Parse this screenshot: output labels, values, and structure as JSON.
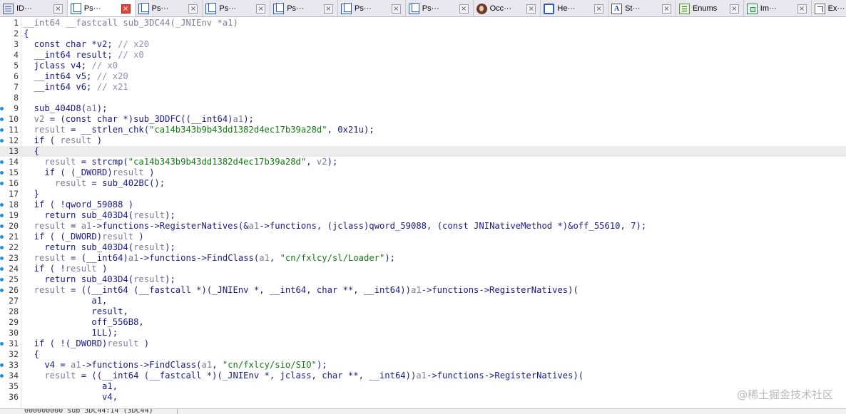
{
  "tabs": [
    {
      "label": "ID···",
      "icon": "ida-view-icon",
      "active": false
    },
    {
      "label": "Ps···",
      "icon": "pseudocode-icon",
      "active": true
    },
    {
      "label": "Ps···",
      "icon": "pseudocode-icon",
      "active": false
    },
    {
      "label": "Ps···",
      "icon": "pseudocode-icon",
      "active": false
    },
    {
      "label": "Ps···",
      "icon": "pseudocode-icon",
      "active": false
    },
    {
      "label": "Ps···",
      "icon": "pseudocode-icon",
      "active": false
    },
    {
      "label": "Ps···",
      "icon": "pseudocode-icon",
      "active": false
    },
    {
      "label": "Occ···",
      "icon": "occurrences-icon",
      "active": false
    },
    {
      "label": "He···",
      "icon": "hex-view-icon",
      "active": false
    },
    {
      "label": "St···",
      "icon": "strings-icon",
      "active": false
    },
    {
      "label": "Enums",
      "icon": "enums-icon",
      "active": false
    },
    {
      "label": "Im···",
      "icon": "imports-icon",
      "active": false
    },
    {
      "label": "Ex···",
      "icon": "exports-icon",
      "active": false
    }
  ],
  "tab_close_glyph": "×",
  "code": {
    "highlighted_line": 13,
    "breakpoint_lines": [
      9,
      10,
      11,
      12,
      14,
      15,
      16,
      18,
      19,
      20,
      21,
      22,
      23,
      24,
      25,
      26,
      31,
      33,
      34
    ],
    "lines": [
      [
        {
          "t": "__int64 __fastcall sub_3DC44(_JNIEnv *a1)",
          "c": "var"
        }
      ],
      [
        {
          "t": "{",
          "c": ""
        }
      ],
      [
        {
          "t": "  const char *v2; ",
          "c": ""
        },
        {
          "t": "// x20",
          "c": "cmt"
        }
      ],
      [
        {
          "t": "  __int64 result; ",
          "c": ""
        },
        {
          "t": "// x0",
          "c": "cmt"
        }
      ],
      [
        {
          "t": "  jclass v4; ",
          "c": ""
        },
        {
          "t": "// x0",
          "c": "cmt"
        }
      ],
      [
        {
          "t": "  __int64 v5; ",
          "c": ""
        },
        {
          "t": "// x20",
          "c": "cmt"
        }
      ],
      [
        {
          "t": "  __int64 v6; ",
          "c": ""
        },
        {
          "t": "// x21",
          "c": "cmt"
        }
      ],
      [
        {
          "t": "",
          "c": ""
        }
      ],
      [
        {
          "t": "  sub_404D8(",
          "c": ""
        },
        {
          "t": "a1",
          "c": "var"
        },
        {
          "t": ");",
          "c": ""
        }
      ],
      [
        {
          "t": "  v2",
          "c": "var"
        },
        {
          "t": " = (const char *)sub_3DDFC((__int64)",
          "c": ""
        },
        {
          "t": "a1",
          "c": "var"
        },
        {
          "t": ");",
          "c": ""
        }
      ],
      [
        {
          "t": "  result",
          "c": "var"
        },
        {
          "t": " = __strlen_chk(",
          "c": ""
        },
        {
          "t": "\"ca14b343b9b43dd1382d4ec17b39a28d\"",
          "c": "str"
        },
        {
          "t": ", 0x21u);",
          "c": ""
        }
      ],
      [
        {
          "t": "  if ( ",
          "c": ""
        },
        {
          "t": "result",
          "c": "var"
        },
        {
          "t": " )",
          "c": ""
        }
      ],
      [
        {
          "t": "  {",
          "c": ""
        }
      ],
      [
        {
          "t": "    result",
          "c": "var"
        },
        {
          "t": " = strcmp(",
          "c": ""
        },
        {
          "t": "\"ca14b343b9b43dd1382d4ec17b39a28d\"",
          "c": "str"
        },
        {
          "t": ", ",
          "c": ""
        },
        {
          "t": "v2",
          "c": "var"
        },
        {
          "t": ");",
          "c": ""
        }
      ],
      [
        {
          "t": "    if ( (_DWORD)",
          "c": ""
        },
        {
          "t": "result",
          "c": "var"
        },
        {
          "t": " )",
          "c": ""
        }
      ],
      [
        {
          "t": "      result",
          "c": "var"
        },
        {
          "t": " = sub_402BC();",
          "c": ""
        }
      ],
      [
        {
          "t": "  }",
          "c": ""
        }
      ],
      [
        {
          "t": "  if ( !qword_59088 )",
          "c": ""
        }
      ],
      [
        {
          "t": "    return sub_403D4(",
          "c": ""
        },
        {
          "t": "result",
          "c": "var"
        },
        {
          "t": ");",
          "c": ""
        }
      ],
      [
        {
          "t": "  result",
          "c": "var"
        },
        {
          "t": " = ",
          "c": ""
        },
        {
          "t": "a1",
          "c": "var"
        },
        {
          "t": "->functions->RegisterNatives(&",
          "c": ""
        },
        {
          "t": "a1",
          "c": "var"
        },
        {
          "t": "->functions, (jclass)qword_59088, (const JNINativeMethod *)&off_55610, 7);",
          "c": ""
        }
      ],
      [
        {
          "t": "  if ( (_DWORD)",
          "c": ""
        },
        {
          "t": "result",
          "c": "var"
        },
        {
          "t": " )",
          "c": ""
        }
      ],
      [
        {
          "t": "    return sub_403D4(",
          "c": ""
        },
        {
          "t": "result",
          "c": "var"
        },
        {
          "t": ");",
          "c": ""
        }
      ],
      [
        {
          "t": "  result",
          "c": "var"
        },
        {
          "t": " = (__int64)",
          "c": ""
        },
        {
          "t": "a1",
          "c": "var"
        },
        {
          "t": "->functions->FindClass(",
          "c": ""
        },
        {
          "t": "a1",
          "c": "var"
        },
        {
          "t": ", ",
          "c": ""
        },
        {
          "t": "\"cn/fxlcy/sl/Loader\"",
          "c": "str"
        },
        {
          "t": ");",
          "c": ""
        }
      ],
      [
        {
          "t": "  if ( !",
          "c": ""
        },
        {
          "t": "result",
          "c": "var"
        },
        {
          "t": " )",
          "c": ""
        }
      ],
      [
        {
          "t": "    return sub_403D4(",
          "c": ""
        },
        {
          "t": "result",
          "c": "var"
        },
        {
          "t": ");",
          "c": ""
        }
      ],
      [
        {
          "t": "  result",
          "c": "var"
        },
        {
          "t": " = ((__int64 (__fastcall *)(_JNIEnv *, __int64, char **, __int64))",
          "c": ""
        },
        {
          "t": "a1",
          "c": "var"
        },
        {
          "t": "->functions->RegisterNatives)(",
          "c": ""
        }
      ],
      [
        {
          "t": "             a1,",
          "c": ""
        }
      ],
      [
        {
          "t": "             result,",
          "c": ""
        }
      ],
      [
        {
          "t": "             off_556B8,",
          "c": ""
        }
      ],
      [
        {
          "t": "             1LL);",
          "c": ""
        }
      ],
      [
        {
          "t": "  if ( !(_DWORD)",
          "c": ""
        },
        {
          "t": "result",
          "c": "var"
        },
        {
          "t": " )",
          "c": ""
        }
      ],
      [
        {
          "t": "  {",
          "c": ""
        }
      ],
      [
        {
          "t": "    v4 = ",
          "c": ""
        },
        {
          "t": "a1",
          "c": "var"
        },
        {
          "t": "->functions->FindClass(",
          "c": ""
        },
        {
          "t": "a1",
          "c": "var"
        },
        {
          "t": ", ",
          "c": ""
        },
        {
          "t": "\"cn/fxlcy/sio/SIO\"",
          "c": "str"
        },
        {
          "t": ");",
          "c": ""
        }
      ],
      [
        {
          "t": "    result",
          "c": "var"
        },
        {
          "t": " = ((__int64 (__fastcall *)(_JNIEnv *, jclass, char **, __int64))",
          "c": ""
        },
        {
          "t": "a1",
          "c": "var"
        },
        {
          "t": "->functions->RegisterNatives)(",
          "c": ""
        }
      ],
      [
        {
          "t": "               a1,",
          "c": ""
        }
      ],
      [
        {
          "t": "               v4,",
          "c": ""
        }
      ]
    ]
  },
  "status": {
    "text": "000000000  sub_3DC44:14 (3DC44)"
  },
  "watermark": "@稀土掘金技术社区"
}
